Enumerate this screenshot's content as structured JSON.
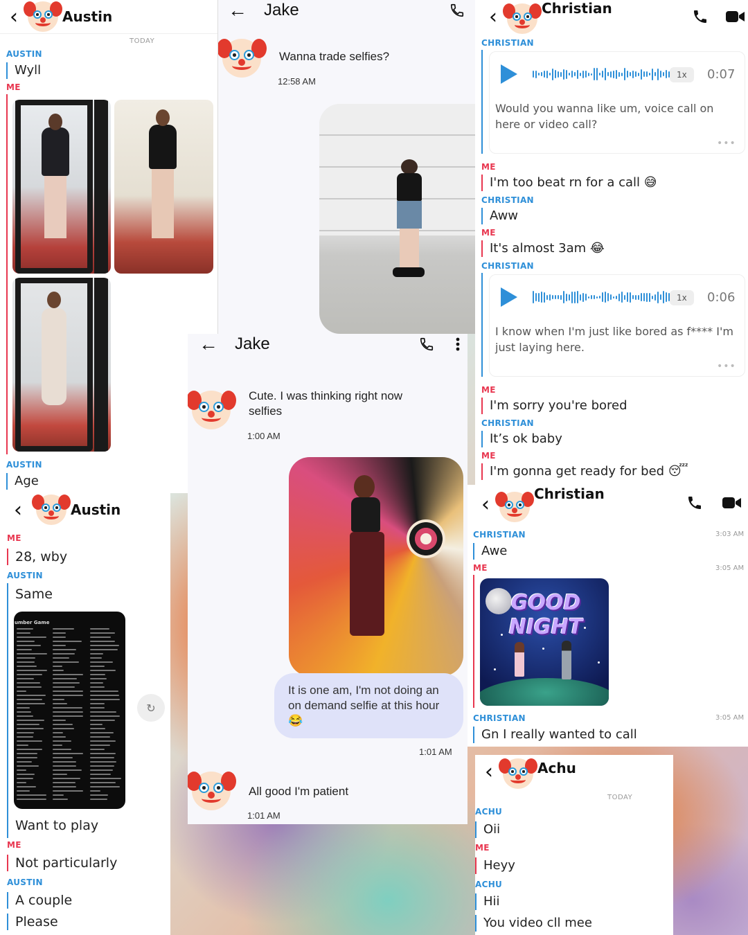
{
  "panels": {
    "austin1": {
      "contact": "Austin",
      "today": "TODAY",
      "messages": [
        {
          "sender": "AUSTIN",
          "text": "Wyll"
        },
        {
          "sender": "ME",
          "text": ""
        },
        {
          "sender": "AUSTIN",
          "text": "Age"
        }
      ]
    },
    "jake1": {
      "contact": "Jake",
      "message": "Wanna trade selfies?",
      "time": "12:58 AM"
    },
    "christian1": {
      "contact": "Christian",
      "sender_christian": "CHRISTIAN",
      "sender_me": "ME",
      "voice1": {
        "speed": "1x",
        "duration": "0:07",
        "transcript": "Would you wanna like um, voice call on here or video call?"
      },
      "msg1": "I'm too beat rn for a call 😅",
      "msg2": "Aww",
      "msg3": "It's almost 3am 😂",
      "voice2": {
        "speed": "1x",
        "duration": "0:06",
        "transcript": "I know when I'm just like bored as f**** I'm just laying here."
      },
      "msg4": "I'm sorry you're bored",
      "msg5": "It’s ok baby",
      "msg6": "I'm gonna get ready for bed 😴",
      "more": "•••"
    },
    "jake2": {
      "contact": "Jake",
      "msg1": "Cute. I was thinking right now selfies",
      "time1": "1:00 AM",
      "bubble": "It is one am, I'm not doing an on demand selfie at this hour 😂",
      "time2": "1:01 AM",
      "msg2": "All good I'm patient",
      "time3": "1:01 AM"
    },
    "austin2": {
      "contact": "Austin",
      "sender_me": "ME",
      "sender_austin": "AUSTIN",
      "msg1": "28, wby",
      "msg2": "Same",
      "msg3": "Want to play",
      "msg4": "Not particularly",
      "msg5": "A couple",
      "msg6": "Please",
      "rules_header": "umber Game"
    },
    "christian2": {
      "contact": "Christian",
      "sender_christian": "CHRISTIAN",
      "sender_me": "ME",
      "msg1": "Awe",
      "time1": "3:03 AM",
      "time2": "3:05 AM",
      "sticker_text": "GOOD NIGHT",
      "msg2": "Gn I really wanted to call",
      "time3": "3:05 AM"
    },
    "achu": {
      "contact": "Achu",
      "today": "TODAY",
      "sender_achu": "ACHU",
      "sender_me": "ME",
      "msg1": "Oii",
      "msg2": "Heyy",
      "msg3": "Hii",
      "msg4": "You video cll mee"
    }
  },
  "icons": {
    "back": "‹",
    "arrow_back": "←",
    "phone": "phone-icon",
    "video": "video-icon",
    "more": "more-vert-icon"
  },
  "colors": {
    "them": "#2e8fd8",
    "me": "#e8364f",
    "bubble": "#dfe2f9"
  }
}
